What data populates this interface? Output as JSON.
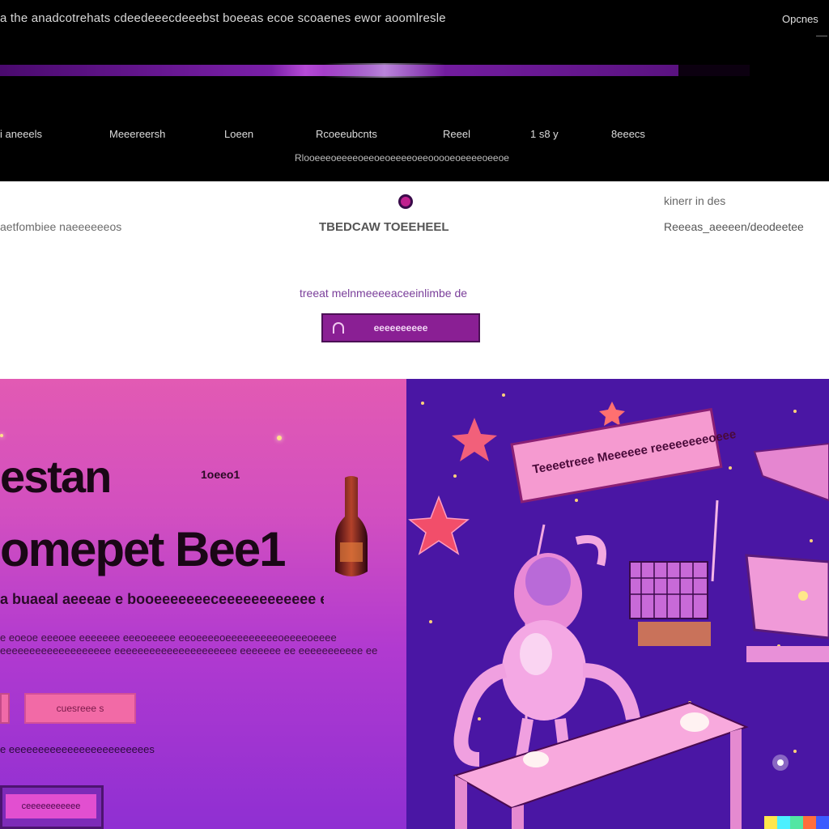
{
  "header": {
    "tagline": "a the anadcotrehats cdeedeeecdeeebst boeeas ecoe scoaenes ewor aoomlresle",
    "top_right": "Opcnes",
    "progress_fraction": 0.905
  },
  "nav": {
    "items": [
      "i aneeels",
      "Meeereersh",
      "Loeen",
      "Rcoeeubcnts",
      "Reeel",
      "1 s8 y",
      "8eeecs"
    ],
    "sub": "Rlooeeeoeeeeoeeoeoeeeeoeeooooeoeeeeoeeoe"
  },
  "info": {
    "left": "aetfombiee naeeeeeeos",
    "center": "TBEDCAW TOEEHEEL",
    "right1": "kinerr in des",
    "right2": "Reeeas_aeeeen/deodeetee",
    "promo": "treeat melnmeeeeaceeinlimbe de",
    "cta": "eeeeeeeeee"
  },
  "hero": {
    "title1": "estan",
    "badge": "1oeeo1",
    "title2": "omepet Bee1",
    "subtitle": "a buaeal aeeeae e booeeeeeeeceeeeeeeeeeee eeee eeeeeeeeeeeeeeeeee",
    "body": "e eoeoe eeeoee eeeeeee eeeoeeeee eeoeeeeoeeeeeeeeeoeeeeoeeee eeeeeeeeeeeeeeeeeee eeeeeeeeeeeeeeeeeeeee eeeeeee ee eeeeeeeeeee ee",
    "button": "cuesreee s",
    "link": "e eeeeeeeeeeeeeeeeeeeeeeees",
    "card_label": "ceeeeeeeeeee"
  },
  "illustration": {
    "banner_text": "Teeeetreee Meeeeee reeeeeeeeoeee"
  },
  "colors": {
    "accent": "#8a1f94",
    "hero_gradient_top": "#e25ab3",
    "hero_gradient_bottom": "#8f2fd2",
    "illustration_bg": "#4a16a4",
    "pink": "#f59ad0"
  },
  "watermark_colors": [
    "#ffe64c",
    "#4cf0ff",
    "#52e6a3",
    "#ff6e3c",
    "#3c5cff"
  ]
}
